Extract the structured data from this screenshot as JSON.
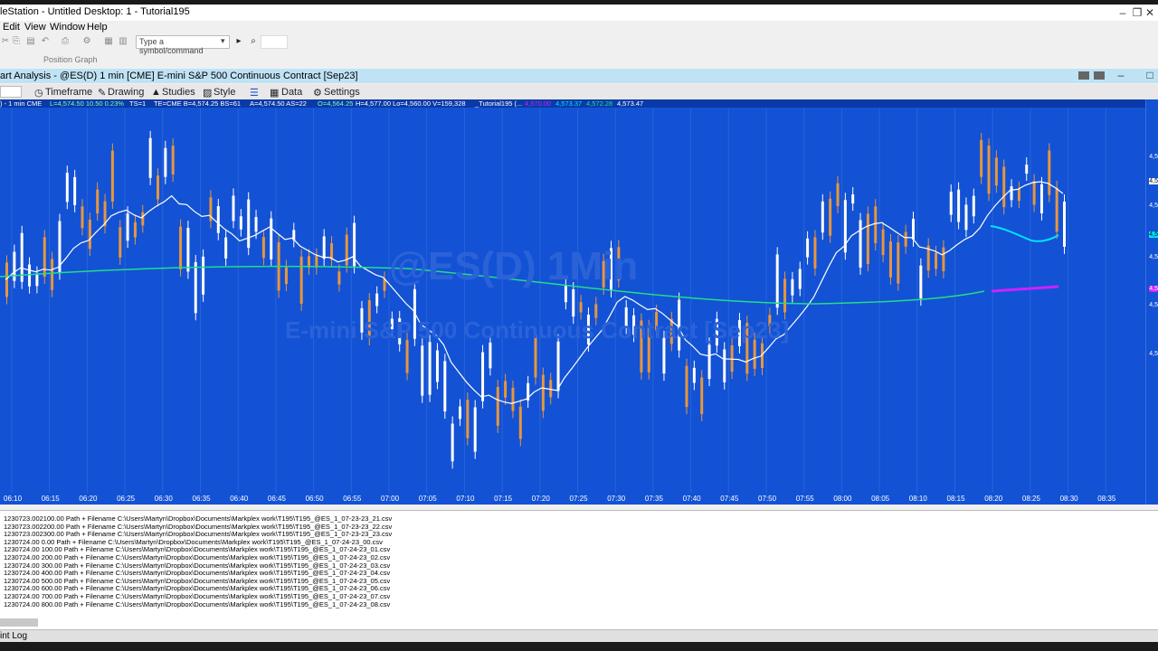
{
  "app": {
    "title": "leStation - Untitled Desktop: 1 - Tutorial195",
    "window_controls": [
      "–",
      "❐",
      "✕"
    ]
  },
  "menu": {
    "items": [
      "Edit",
      "View",
      "Window",
      "Help"
    ]
  },
  "toolbar": {
    "symbol_placeholder": "Type a symbol/command",
    "position_graph": "Position Graph"
  },
  "chart_window": {
    "title": "art Analysis - @ES(D) 1 min [CME] E-mini S&P 500 Continuous Contract [Sep23]",
    "toolbar": [
      "Timeframe",
      "Drawing",
      "Studies",
      "Style",
      "Data",
      "Settings"
    ]
  },
  "info_bar": {
    "symbol": ") - 1 min  CME",
    "last": "L=4,574.50  10.50  0.23%",
    "ts": "TS=1",
    "te": "TE=CME  B=4,574.25  BS=61",
    "ask": "A=4,574.50  AS=22",
    "open": "O=4,564.25",
    "high_low": "H=4,577.00  Lo=4,560.00  V=159,328",
    "study": "_Tutorial195 (...",
    "v1": "4,570.00",
    "v2": "4,573.37",
    "v3": "4,572.28",
    "v4": "4,573.47"
  },
  "watermark": {
    "line1": "@ES(D) 1Min",
    "line2": "E-mini S&P 500 Continuous Contract [Sep23]"
  },
  "price_labels": [
    "4,5",
    "4,5",
    "4,5",
    "4,5",
    "4,5",
    "4,5",
    "4,5",
    "4,5"
  ],
  "time_labels": [
    "06:10",
    "06:15",
    "06:20",
    "06:25",
    "06:30",
    "06:35",
    "06:40",
    "06:45",
    "06:50",
    "06:55",
    "07:00",
    "07:05",
    "07:10",
    "07:15",
    "07:20",
    "07:25",
    "07:30",
    "07:35",
    "07:40",
    "07:45",
    "07:50",
    "07:55",
    "08:00",
    "08:05",
    "08:10",
    "08:15",
    "08:20",
    "08:25",
    "08:30",
    "08:35"
  ],
  "log_lines": [
    "1230723.002100.00 Path + Filename C:\\Users\\Martyn\\Dropbox\\Documents\\Markplex work\\T195\\T195_@ES_1_07-23-23_21.csv",
    "1230723.002200.00 Path + Filename C:\\Users\\Martyn\\Dropbox\\Documents\\Markplex work\\T195\\T195_@ES_1_07-23-23_22.csv",
    "1230723.002300.00 Path + Filename C:\\Users\\Martyn\\Dropbox\\Documents\\Markplex work\\T195\\T195_@ES_1_07-23-23_23.csv",
    "1230724.00    0.00 Path + Filename C:\\Users\\Martyn\\Dropbox\\Documents\\Markplex work\\T195\\T195_@ES_1_07-24-23_00.csv",
    "1230724.00  100.00 Path + Filename C:\\Users\\Martyn\\Dropbox\\Documents\\Markplex work\\T195\\T195_@ES_1_07-24-23_01.csv",
    "1230724.00  200.00 Path + Filename C:\\Users\\Martyn\\Dropbox\\Documents\\Markplex work\\T195\\T195_@ES_1_07-24-23_02.csv",
    "1230724.00  300.00 Path + Filename C:\\Users\\Martyn\\Dropbox\\Documents\\Markplex work\\T195\\T195_@ES_1_07-24-23_03.csv",
    "1230724.00  400.00 Path + Filename C:\\Users\\Martyn\\Dropbox\\Documents\\Markplex work\\T195\\T195_@ES_1_07-24-23_04.csv",
    "1230724.00  500.00 Path + Filename C:\\Users\\Martyn\\Dropbox\\Documents\\Markplex work\\T195\\T195_@ES_1_07-24-23_05.csv",
    "1230724.00  600.00 Path + Filename C:\\Users\\Martyn\\Dropbox\\Documents\\Markplex work\\T195\\T195_@ES_1_07-24-23_06.csv",
    "1230724.00  700.00 Path + Filename C:\\Users\\Martyn\\Dropbox\\Documents\\Markplex work\\T195\\T195_@ES_1_07-24-23_07.csv",
    "1230724.00  800.00 Path + Filename C:\\Users\\Martyn\\Dropbox\\Documents\\Markplex work\\T195\\T195_@ES_1_07-24-23_08.csv"
  ],
  "status_bar": {
    "label": "int Log"
  },
  "colors": {
    "chart_bg": "#1352d4",
    "up_candle": "#ffffff",
    "down_candle": "#e8963c",
    "fast_ma": "#ffffff",
    "slow_ma": "#22dd88",
    "cyan_line": "#00e5ff",
    "magenta_line": "#cc22ff"
  }
}
